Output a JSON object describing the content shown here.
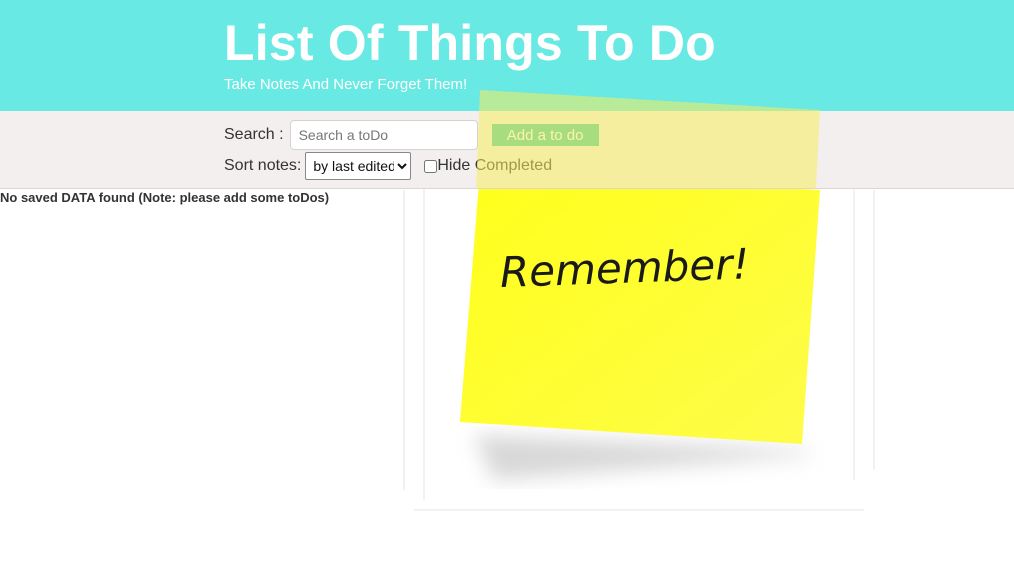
{
  "header": {
    "title": "List Of Things To Do",
    "subtitle": "Take Notes And Never Forget Them!"
  },
  "toolbar": {
    "search_label": "Search :",
    "search_placeholder": "Search a toDo",
    "search_value": "",
    "add_button_label": "Add a to do",
    "sort_label": "Sort notes:",
    "sort_selected": "by last edited",
    "sort_options": [
      "by last edited"
    ],
    "hide_completed_label": "Hide Completed",
    "hide_completed_checked": false
  },
  "main": {
    "empty_message": "No saved DATA found (Note: please add some toDos)"
  },
  "background": {
    "note_text": "Remember!",
    "note_color": "#fefc3c"
  },
  "colors": {
    "header_bg": "#68e9e3",
    "toolbar_bg": "#f4efef",
    "accent_button": "#46c9a6"
  }
}
